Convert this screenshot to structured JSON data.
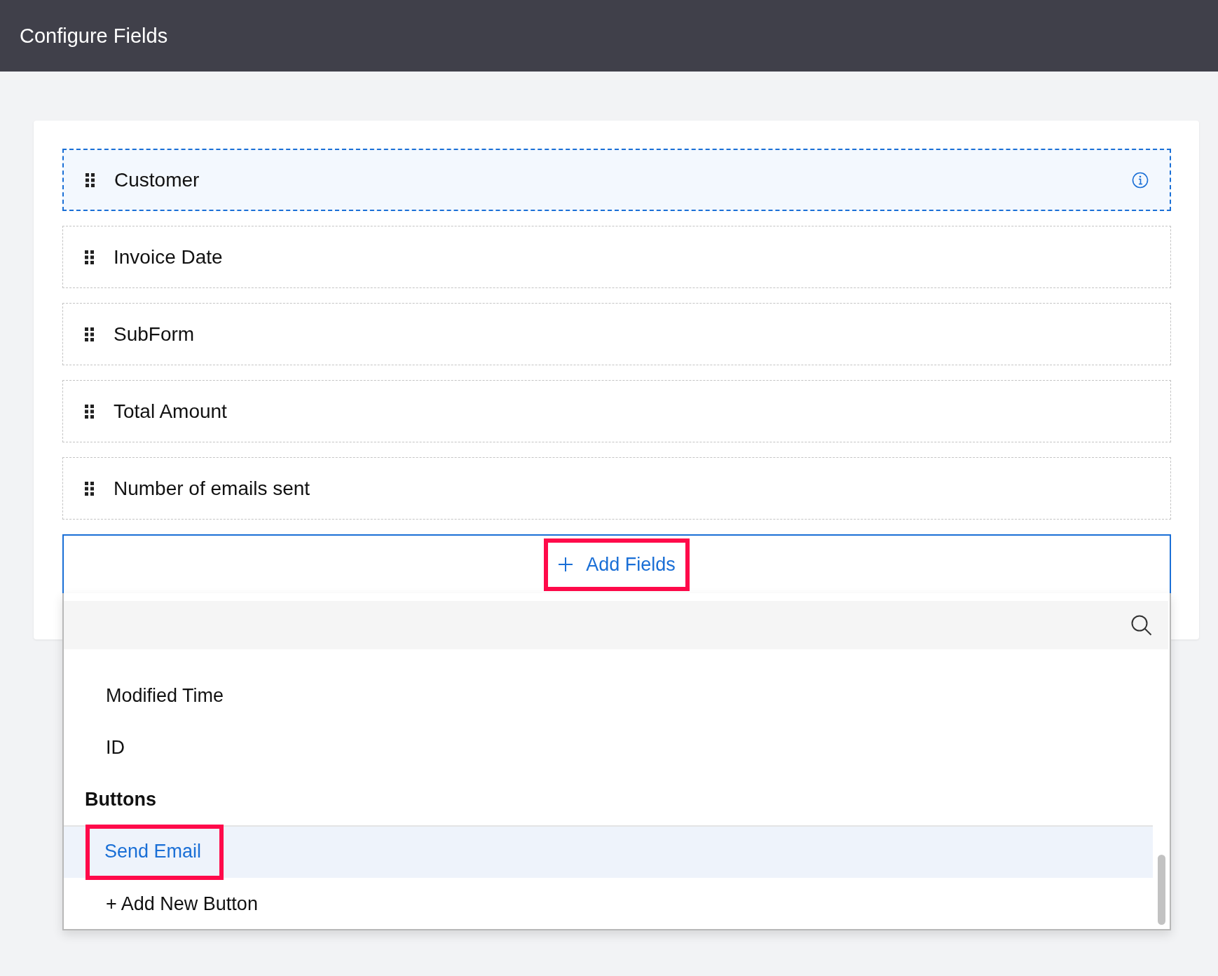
{
  "header": {
    "title": "Configure Fields"
  },
  "fields": [
    {
      "label": "Customer",
      "selected": true
    },
    {
      "label": "Invoice Date",
      "selected": false
    },
    {
      "label": "SubForm",
      "selected": false
    },
    {
      "label": "Total Amount",
      "selected": false
    },
    {
      "label": "Number of emails sent",
      "selected": false
    }
  ],
  "add_fields": {
    "label": "Add Fields",
    "highlighted": true,
    "open": true
  },
  "dropdown": {
    "items": [
      {
        "label": "Modified Time",
        "selected": false
      },
      {
        "label": "ID",
        "selected": false
      }
    ],
    "buttons_section": {
      "heading": "Buttons",
      "items": [
        {
          "label": "Send Email",
          "selected": true,
          "highlighted": true
        }
      ]
    },
    "add_new_button": "+ Add New Button"
  }
}
